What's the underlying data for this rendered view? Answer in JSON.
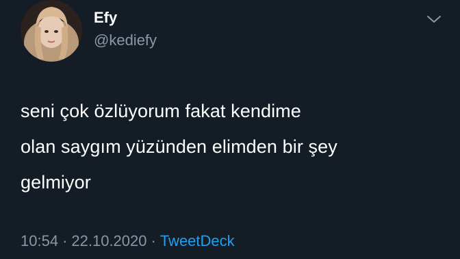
{
  "user": {
    "display_name": "Efy",
    "handle": "@kediefy"
  },
  "tweet": {
    "lines": [
      "seni çok özlüyorum fakat kendime",
      "olan saygım yüzünden elimden bir şey",
      "gelmiyor"
    ],
    "time": "10:54",
    "separator": "·",
    "date": "22.10.2020",
    "source": "TweetDeck"
  },
  "icons": {
    "menu": "chevron-down-icon"
  },
  "colors": {
    "background": "#141d26",
    "text": "#ffffff",
    "muted": "#8899a6",
    "link": "#1da1f2"
  }
}
